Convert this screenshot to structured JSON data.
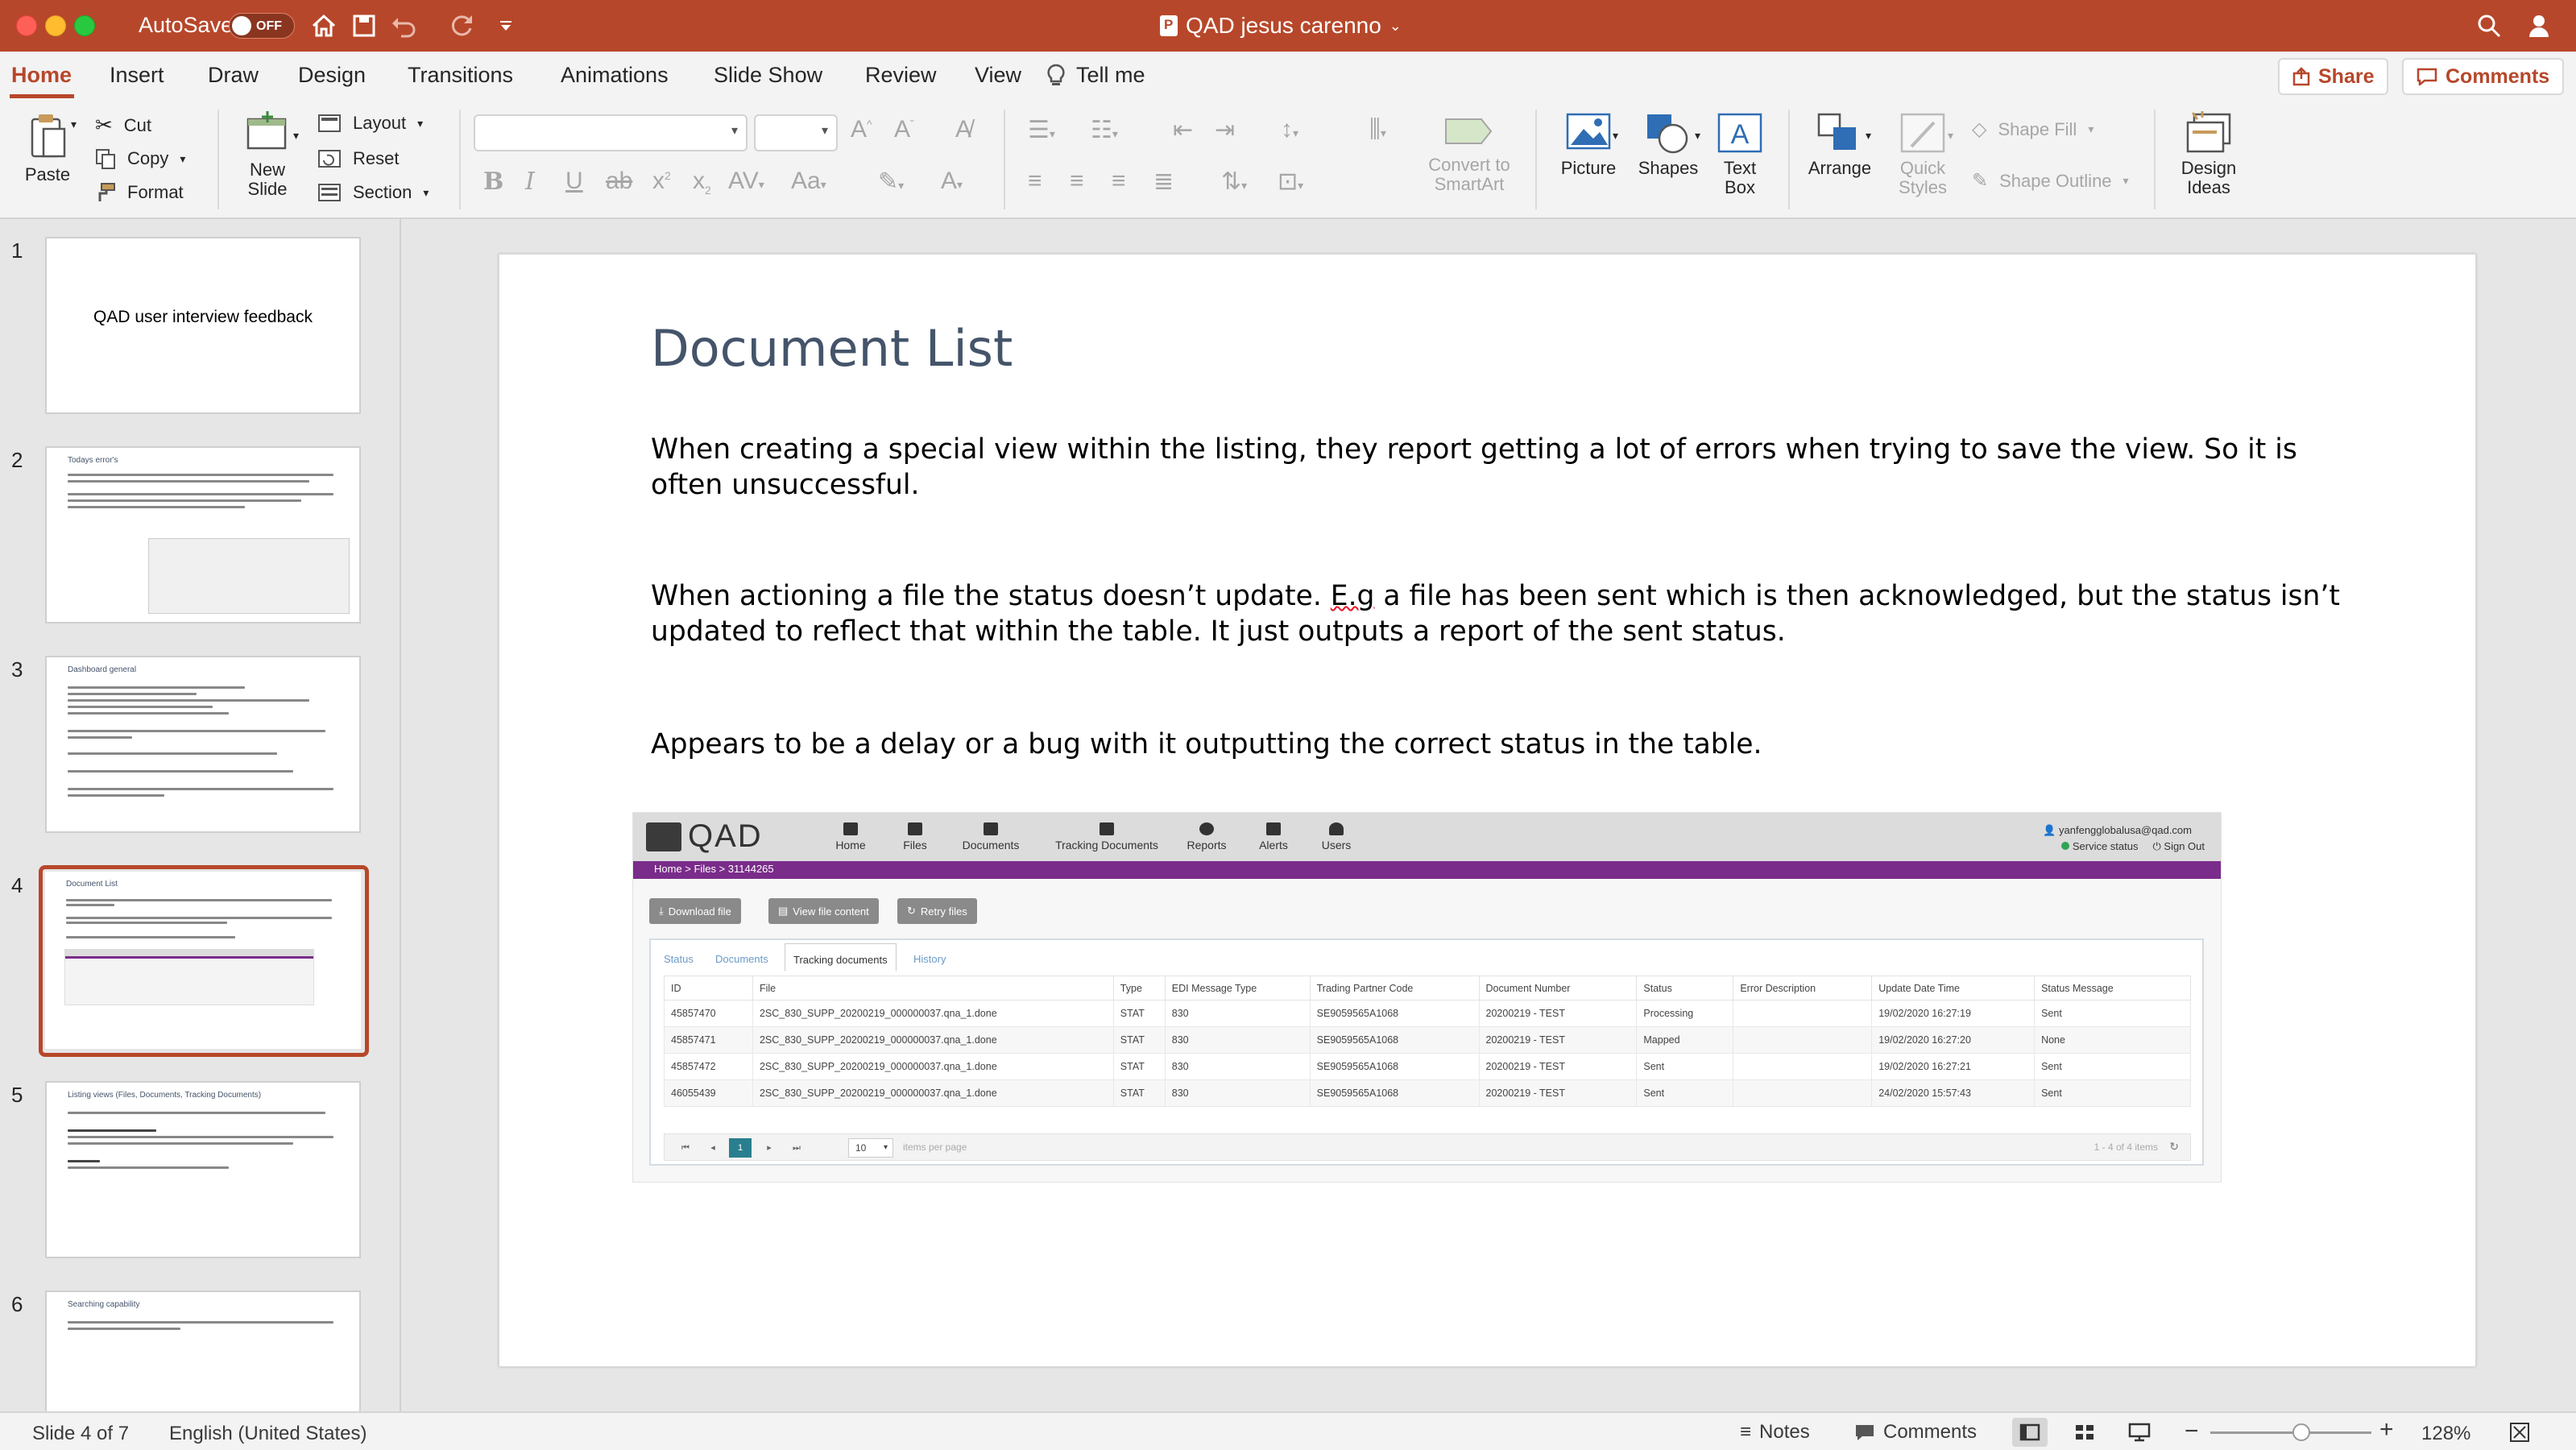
{
  "titlebar": {
    "autosave_label": "AutoSave",
    "autosave_state": "OFF",
    "doc_title": "QAD jesus carenno"
  },
  "tabs": [
    {
      "label": "Home"
    },
    {
      "label": "Insert"
    },
    {
      "label": "Draw"
    },
    {
      "label": "Design"
    },
    {
      "label": "Transitions"
    },
    {
      "label": "Animations"
    },
    {
      "label": "Slide Show"
    },
    {
      "label": "Review"
    },
    {
      "label": "View"
    },
    {
      "label": "Tell me"
    }
  ],
  "header_buttons": {
    "share": "Share",
    "comments": "Comments"
  },
  "ribbon": {
    "paste": "Paste",
    "cut": "Cut",
    "copy": "Copy",
    "format": "Format",
    "new_slide": "New\nSlide",
    "layout": "Layout",
    "reset": "Reset",
    "section": "Section",
    "convert_smartart": "Convert to\nSmartArt",
    "picture": "Picture",
    "shapes": "Shapes",
    "text_box": "Text\nBox",
    "arrange": "Arrange",
    "quick_styles": "Quick\nStyles",
    "shape_fill": "Shape Fill",
    "shape_outline": "Shape Outline",
    "design_ideas": "Design\nIdeas"
  },
  "thumbnails": [
    {
      "num": "1",
      "title": "QAD user interview feedback"
    },
    {
      "num": "2",
      "title": "Todays error's"
    },
    {
      "num": "3",
      "title": "Dashboard general"
    },
    {
      "num": "4",
      "title": "Document List"
    },
    {
      "num": "5",
      "title": "Listing views (Files, Documents, Tracking Documents)"
    },
    {
      "num": "6",
      "title": "Searching capability"
    }
  ],
  "slide": {
    "title": "Document List",
    "p1": "When creating a special view within the listing, they report getting a lot of errors when trying to save the view. So it is often unsuccessful.",
    "p2_a": "When actioning a file the status doesn’t update. ",
    "p2_eg": "E.g",
    "p2_b": " a file has been sent which is then acknowledged, but the status isn’t updated to reflect that within the table. It just outputs a report of the sent status.",
    "p3": "Appears to be a delay or a bug with it outputting the correct status in the table."
  },
  "qad": {
    "logo": "QAD",
    "nav": [
      {
        "label": "Home"
      },
      {
        "label": "Files"
      },
      {
        "label": "Documents"
      },
      {
        "label": "Tracking Documents"
      },
      {
        "label": "Reports"
      },
      {
        "label": "Alerts"
      },
      {
        "label": "Users"
      }
    ],
    "user_email": "yanfengglobalusa@qad.com",
    "service_status": "Service status",
    "sign_out": "Sign Out",
    "breadcrumb": "Home > Files > 31144265",
    "buttons": {
      "download": "Download file",
      "view": "View file content",
      "retry": "Retry files"
    },
    "inner_tabs": [
      {
        "label": "Status"
      },
      {
        "label": "Documents"
      },
      {
        "label": "Tracking documents"
      },
      {
        "label": "History"
      }
    ],
    "columns": [
      "ID",
      "File",
      "Type",
      "EDI Message Type",
      "Trading Partner Code",
      "Document Number",
      "Status",
      "Error Description",
      "Update Date Time",
      "Status Message"
    ],
    "rows": [
      {
        "id": "45857470",
        "file": "2SC_830_SUPP_20200219_000000037.qna_1.done",
        "type": "STAT",
        "edi": "830",
        "partner": "SE9059565A1068",
        "docnum": "20200219 - TEST",
        "status": "Processing",
        "error": "",
        "updated": "19/02/2020 16:27:19",
        "message": "Sent"
      },
      {
        "id": "45857471",
        "file": "2SC_830_SUPP_20200219_000000037.qna_1.done",
        "type": "STAT",
        "edi": "830",
        "partner": "SE9059565A1068",
        "docnum": "20200219 - TEST",
        "status": "Mapped",
        "error": "",
        "updated": "19/02/2020 16:27:20",
        "message": "None"
      },
      {
        "id": "45857472",
        "file": "2SC_830_SUPP_20200219_000000037.qna_1.done",
        "type": "STAT",
        "edi": "830",
        "partner": "SE9059565A1068",
        "docnum": "20200219 - TEST",
        "status": "Sent",
        "error": "",
        "updated": "19/02/2020 16:27:21",
        "message": "Sent"
      },
      {
        "id": "46055439",
        "file": "2SC_830_SUPP_20200219_000000037.qna_1.done",
        "type": "STAT",
        "edi": "830",
        "partner": "SE9059565A1068",
        "docnum": "20200219 - TEST",
        "status": "Sent",
        "error": "",
        "updated": "24/02/2020 15:57:43",
        "message": "Sent"
      }
    ],
    "pager": {
      "current": "1",
      "per_page": "10",
      "per_page_label": "items per page",
      "count": "1 - 4 of 4 items"
    }
  },
  "statusbar": {
    "slide_pos": "Slide 4 of 7",
    "language": "English (United States)",
    "notes": "Notes",
    "comments": "Comments",
    "zoom": "128%"
  },
  "colors": {
    "accent": "#b7472a",
    "slide_title": "#44546a",
    "qad_purple": "#7a2c8a"
  }
}
